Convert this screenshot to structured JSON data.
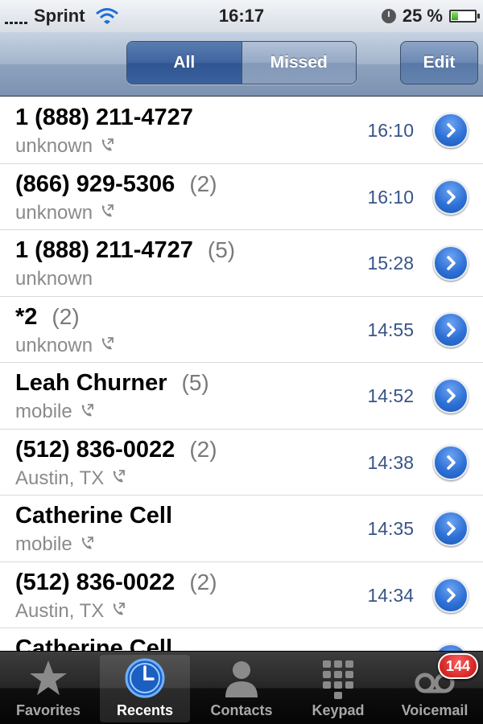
{
  "status_bar": {
    "carrier": "Sprint",
    "time": "16:17",
    "battery_percent": "25 %",
    "battery_level": 0.25,
    "icons": [
      "signal-icon",
      "wifi-icon",
      "alarm-clock-icon",
      "battery-icon"
    ]
  },
  "nav": {
    "segments": [
      {
        "label": "All",
        "selected": true
      },
      {
        "label": "Missed",
        "selected": false
      }
    ],
    "edit_label": "Edit"
  },
  "calls": [
    {
      "name": "1 (888) 211-4727",
      "count": "",
      "label": "unknown",
      "phone_icon": true,
      "time": "16:10"
    },
    {
      "name": "(866) 929-5306",
      "count": "(2)",
      "label": "unknown",
      "phone_icon": true,
      "time": "16:10"
    },
    {
      "name": "1 (888) 211-4727",
      "count": "(5)",
      "label": "unknown",
      "phone_icon": false,
      "time": "15:28"
    },
    {
      "name": "*2",
      "count": "(2)",
      "label": "unknown",
      "phone_icon": true,
      "time": "14:55"
    },
    {
      "name": "Leah Churner",
      "count": "(5)",
      "label": "mobile",
      "phone_icon": true,
      "time": "14:52"
    },
    {
      "name": "(512) 836-0022",
      "count": "(2)",
      "label": "Austin, TX",
      "phone_icon": true,
      "time": "14:38"
    },
    {
      "name": "Catherine Cell",
      "count": "",
      "label": "mobile",
      "phone_icon": true,
      "time": "14:35"
    },
    {
      "name": "(512) 836-0022",
      "count": "(2)",
      "label": "Austin, TX",
      "phone_icon": true,
      "time": "14:34"
    },
    {
      "name": "Catherine Cell",
      "count": "",
      "label": "",
      "phone_icon": false,
      "time": ""
    }
  ],
  "tabs": [
    {
      "label": "Favorites",
      "icon": "star-icon",
      "active": false
    },
    {
      "label": "Recents",
      "icon": "clock-icon",
      "active": true
    },
    {
      "label": "Contacts",
      "icon": "person-icon",
      "active": false
    },
    {
      "label": "Keypad",
      "icon": "keypad-icon",
      "active": false
    },
    {
      "label": "Voicemail",
      "icon": "voicemail-icon",
      "active": false,
      "badge": "144"
    }
  ],
  "colors": {
    "time_text": "#385487",
    "detail_button": "#2e71d6",
    "badge": "#d01515"
  }
}
